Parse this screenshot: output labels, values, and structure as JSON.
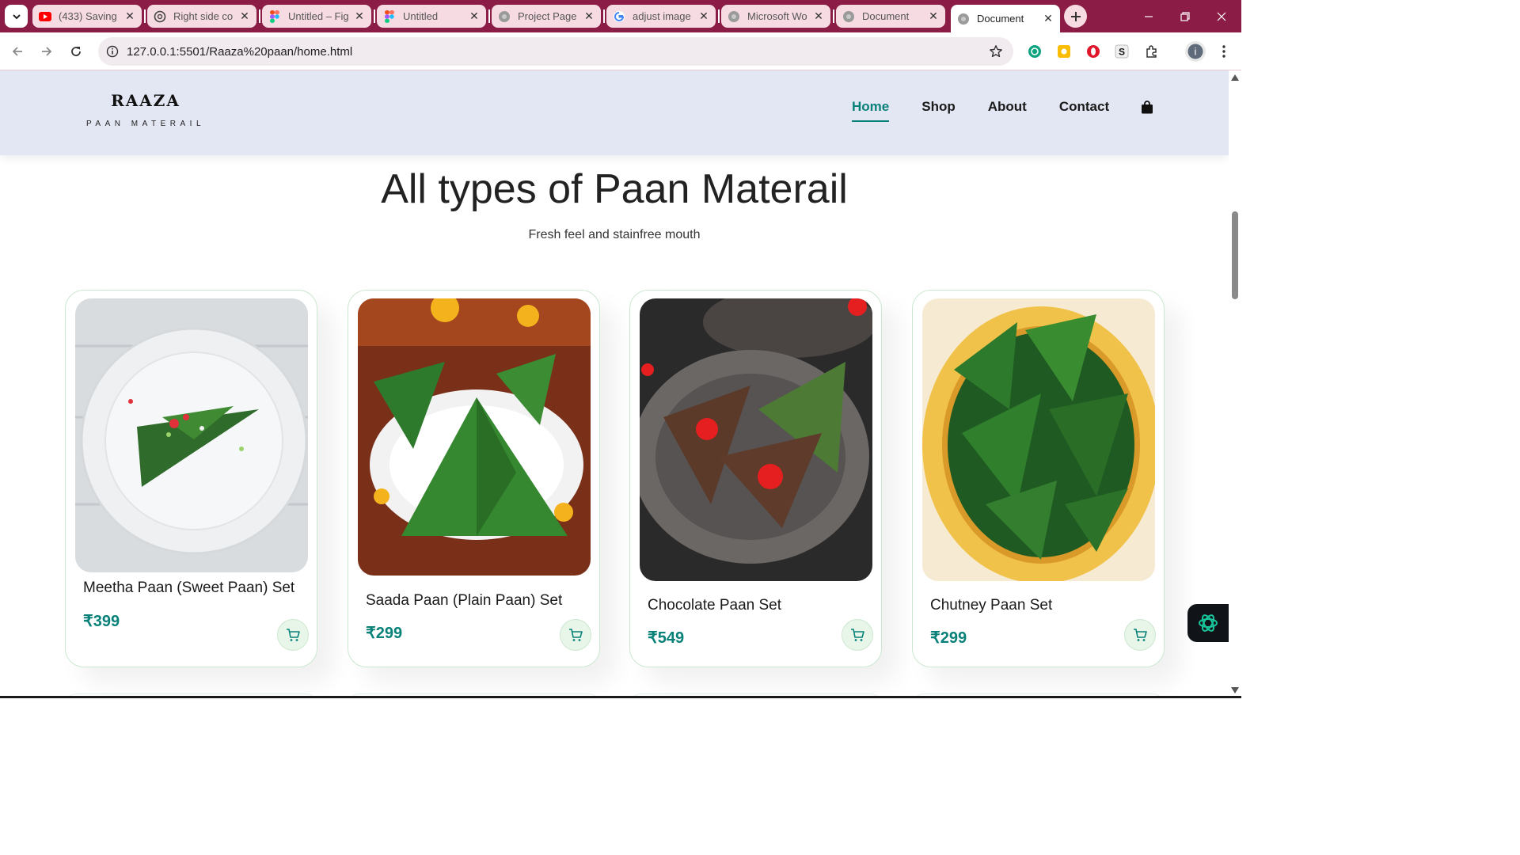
{
  "browser": {
    "tabs": [
      {
        "title": "(433) Saving",
        "icon": "youtube-icon",
        "color": "#ff0000"
      },
      {
        "title": "Right side co",
        "icon": "chatgpt-icon",
        "color": "#444444"
      },
      {
        "title": "Untitled – Fig",
        "icon": "figma-icon",
        "color": "#a259ff"
      },
      {
        "title": "Untitled",
        "icon": "figma-icon",
        "color": "#a259ff"
      },
      {
        "title": "Project Page",
        "icon": "globe-icon",
        "color": "#888888"
      },
      {
        "title": "adjust image",
        "icon": "google-icon",
        "color": "#4285f4"
      },
      {
        "title": "Microsoft Wo",
        "icon": "globe-icon",
        "color": "#888888"
      },
      {
        "title": "Document",
        "icon": "globe-icon",
        "color": "#888888"
      },
      {
        "title": "Document",
        "icon": "globe-icon",
        "color": "#888888",
        "active": true
      }
    ],
    "url": "127.0.0.1:5501/Raaza%20paan/home.html",
    "profile_initial": "i"
  },
  "site": {
    "brand_name": "RAAZA",
    "brand_sub": "PAAN MATERAIL",
    "nav": [
      {
        "label": "Home",
        "active": true
      },
      {
        "label": "Shop",
        "active": false
      },
      {
        "label": "About",
        "active": false
      },
      {
        "label": "Contact",
        "active": false
      }
    ],
    "accent_color": "#088178"
  },
  "hero": {
    "title": "All types of Paan Materail",
    "subtitle": "Fresh feel and stainfree mouth"
  },
  "products": [
    {
      "name": "Meetha Paan (Sweet Paan) Set",
      "price": "₹399",
      "image": "sweet-paan-on-white-plate"
    },
    {
      "name": "Saada Paan (Plain Paan) Set",
      "price": "₹299",
      "image": "plain-paan-on-doily"
    },
    {
      "name": "Chocolate Paan Set",
      "price": "₹549",
      "image": "chocolate-paan-on-metal-plate"
    },
    {
      "name": "Chutney Paan Set",
      "price": "₹299",
      "image": "betel-leaves-in-brass-bowl"
    }
  ]
}
